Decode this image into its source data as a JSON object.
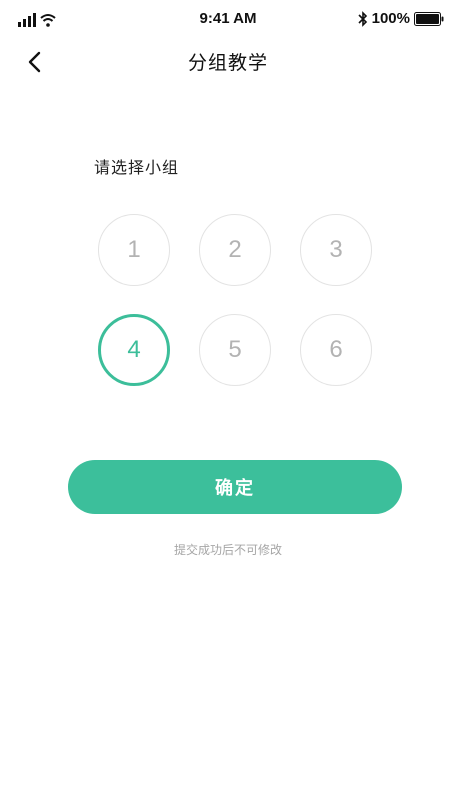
{
  "status_bar": {
    "time": "9:41 AM",
    "battery_percent": "100%",
    "icons": [
      "signal-icon",
      "wifi-icon",
      "bluetooth-icon",
      "battery-icon"
    ]
  },
  "nav": {
    "title": "分组教学",
    "back_icon": "chevron-left-icon"
  },
  "group_select": {
    "label": "请选择小组",
    "options": [
      "1",
      "2",
      "3",
      "4",
      "5",
      "6"
    ],
    "selected": "4"
  },
  "actions": {
    "confirm_label": "确定",
    "hint": "提交成功后不可修改"
  },
  "colors": {
    "accent": "#3cbf9b",
    "unselected_text": "#b3b3b3",
    "unselected_border": "#e3e3e3",
    "hint": "#a6a6a6"
  }
}
